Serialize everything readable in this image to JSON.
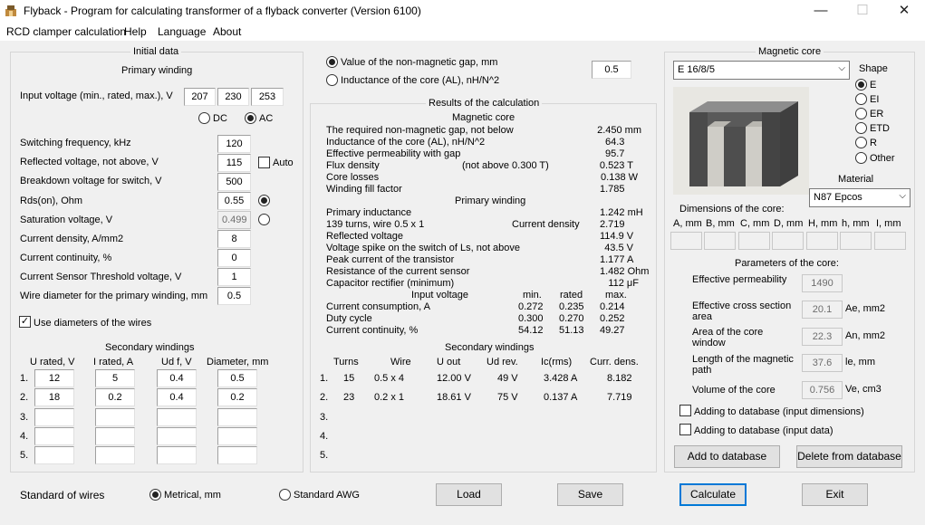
{
  "window": {
    "title": "Flyback - Program for calculating transformer of a flyback converter (Version 6100)",
    "minimize": "—",
    "maximize": "☐",
    "close": "✕"
  },
  "menu": [
    "RCD clamper calculation",
    "Help",
    "Language",
    "About"
  ],
  "initial": {
    "title": "Initial data",
    "primary_title": "Primary winding",
    "input_voltage_label": "Input voltage (min., rated, max.), V",
    "vin_min": "207",
    "vin_rated": "230",
    "vin_max": "253",
    "dc_label": "DC",
    "ac_label": "AC",
    "rows": [
      {
        "label": "Switching frequency, kHz",
        "value": "120"
      },
      {
        "label": "Reflected voltage, not above, V",
        "value": "115"
      },
      {
        "label": "Breakdown voltage for switch, V",
        "value": "500"
      },
      {
        "label": "Rds(on), Ohm",
        "value": "0.55"
      },
      {
        "label": "Saturation voltage, V",
        "value": "0.499"
      },
      {
        "label": "Current density, A/mm2",
        "value": "8"
      },
      {
        "label": "Current continuity, %",
        "value": "0"
      },
      {
        "label": "Current Sensor Threshold voltage, V",
        "value": "1"
      },
      {
        "label": "Wire diameter for the primary winding, mm",
        "value": "0.5"
      }
    ],
    "auto_label": "Auto",
    "use_diam_label": "Use diameters of the wires",
    "secondary_title": "Secondary windings",
    "sec_headers": [
      "U rated, V",
      "I rated, A",
      "Ud f, V",
      "Diameter, mm"
    ],
    "sec_rows": [
      {
        "n": "1.",
        "u": "12",
        "i": "5",
        "ud": "0.4",
        "d": "0.5"
      },
      {
        "n": "2.",
        "u": "18",
        "i": "0.2",
        "ud": "0.4",
        "d": "0.2"
      },
      {
        "n": "3.",
        "u": "",
        "i": "",
        "ud": "",
        "d": ""
      },
      {
        "n": "4.",
        "u": "",
        "i": "",
        "ud": "",
        "d": ""
      },
      {
        "n": "5.",
        "u": "",
        "i": "",
        "ud": "",
        "d": ""
      }
    ]
  },
  "gap": {
    "gap_label": "Value of the non-magnetic gap, mm",
    "al_label": "Inductance of the core (AL), nH/N^2",
    "value": "0.5"
  },
  "results": {
    "title": "Results of the calculation",
    "magnetic_core_title": "Magnetic core",
    "mc_rows": [
      {
        "label": "The required non-magnetic gap, not below",
        "mid": "",
        "value": "2.450 mm"
      },
      {
        "label": "Inductance of the core (AL), nH/N^2",
        "mid": "",
        "value": "64.3"
      },
      {
        "label": "Effective permeability with gap",
        "mid": "",
        "value": "95.7"
      },
      {
        "label": "Flux density",
        "mid": "(not above 0.300 T)",
        "value": "0.523 T"
      },
      {
        "label": "Core losses",
        "mid": "",
        "value": "0.138 W"
      },
      {
        "label": "Winding fill factor",
        "mid": "",
        "value": "1.785"
      }
    ],
    "primary_title": "Primary winding",
    "pw_rows": [
      {
        "label": "Primary inductance",
        "mid": "",
        "value": "1.242 mH"
      },
      {
        "label": "139 turns, wire 0.5 x 1",
        "mid": "Current density",
        "value": "2.719"
      },
      {
        "label": "Reflected voltage",
        "mid": "",
        "value": "114.9 V"
      },
      {
        "label": "Voltage spike on the switch of Ls, not above",
        "mid": "",
        "value": "43.5 V"
      },
      {
        "label": "Peak current of the transistor",
        "mid": "",
        "value": "1.177 A"
      },
      {
        "label": "Resistance of the current sensor",
        "mid": "",
        "value": "1.482 Ohm"
      },
      {
        "label": "Capacitor rectifier (minimum)",
        "mid": "",
        "value": "112 μF"
      }
    ],
    "iv_header": {
      "title": "Input voltage",
      "min": "min.",
      "rated": "rated",
      "max": "max."
    },
    "iv_rows": [
      {
        "label": "Current consumption, A",
        "min": "0.272",
        "rated": "0.235",
        "max": "0.214"
      },
      {
        "label": "Duty cycle",
        "min": "0.300",
        "rated": "0.270",
        "max": "0.252"
      },
      {
        "label": "Current continuity, %",
        "min": "54.12",
        "rated": "51.13",
        "max": "49.27"
      }
    ],
    "secondary_title": "Secondary windings",
    "sw_headers": [
      "Turns",
      "Wire",
      "U out",
      "Ud rev.",
      "Ic(rms)",
      "Curr. dens."
    ],
    "sw_rows": [
      {
        "n": "1.",
        "turns": "15",
        "wire": "0.5 x 4",
        "uout": "12.00 V",
        "ud": "49 V",
        "ic": "3.428 A",
        "cd": "8.182"
      },
      {
        "n": "2.",
        "turns": "23",
        "wire": "0.2 x 1",
        "uout": "18.61 V",
        "ud": "75 V",
        "ic": "0.137 A",
        "cd": "7.719"
      },
      {
        "n": "3.",
        "turns": "",
        "wire": "",
        "uout": "",
        "ud": "",
        "ic": "",
        "cd": ""
      },
      {
        "n": "4.",
        "turns": "",
        "wire": "",
        "uout": "",
        "ud": "",
        "ic": "",
        "cd": ""
      },
      {
        "n": "5.",
        "turns": "",
        "wire": "",
        "uout": "",
        "ud": "",
        "ic": "",
        "cd": ""
      }
    ]
  },
  "core": {
    "title": "Magnetic core",
    "selected": "E 16/8/5",
    "shape_title": "Shape",
    "shapes": [
      "E",
      "EI",
      "ER",
      "ETD",
      "R",
      "Other"
    ],
    "material_title": "Material",
    "material": "N87 Epcos",
    "dims_title": "Dimensions of the core:",
    "dim_headers": [
      "A, mm",
      "B, mm",
      "C, mm",
      "D, mm",
      "H, mm",
      "h, mm",
      "I, mm"
    ],
    "params_title": "Parameters of the core:",
    "params": [
      {
        "label": "Effective permeability",
        "value": "1490",
        "unit": ""
      },
      {
        "label": "Effective cross section area",
        "value": "20.1",
        "unit": "Ae, mm2"
      },
      {
        "label": "Area of the core window",
        "value": "22.3",
        "unit": "An, mm2"
      },
      {
        "label": "Length of the magnetic path",
        "value": "37.6",
        "unit": "le, mm"
      },
      {
        "label": "Volume of the core",
        "value": "0.756",
        "unit": "Ve, cm3"
      }
    ],
    "add_dims_label": "Adding to database (input dimensions)",
    "add_data_label": "Adding to database (input data)",
    "add_btn": "Add to database",
    "delete_btn": "Delete from database"
  },
  "bottom": {
    "standard_label": "Standard of wires",
    "metric_label": "Metrical, mm",
    "awg_label": "Standard AWG",
    "load": "Load",
    "save": "Save",
    "calculate": "Calculate",
    "exit": "Exit"
  }
}
